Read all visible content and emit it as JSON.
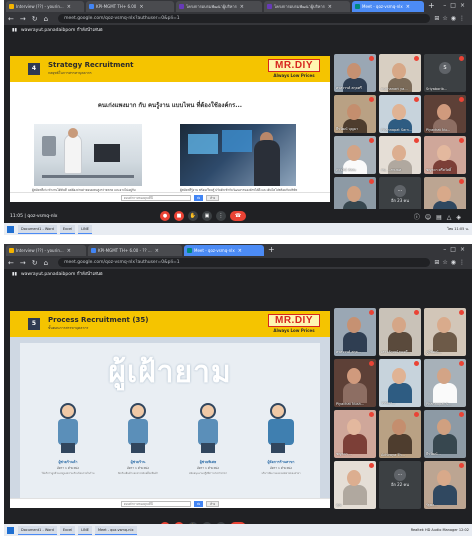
{
  "shot1": {
    "tabs": [
      {
        "label": "Interview (??) - yourin...",
        "color": "#f4b400"
      },
      {
        "label": "KPI-MGMT TH+ 6.00",
        "color": "#4285f4"
      },
      {
        "label": "โครงการอบรมพัฒนาผู้บริหาร",
        "color": "#673ab7"
      },
      {
        "label": "โครงการอบรมพัฒนาผู้บริหาร",
        "color": "#673ab7"
      },
      {
        "label": "Meet - qoz-vsmq-nlx",
        "color": "#00897b",
        "active": true
      }
    ],
    "url": "meet.google.com/qoz-vsmq-nlx?authuser=0&pli=1",
    "presenter": "wawrayut.panadaibpom กำลังนำเสนอ",
    "slide": {
      "number": "4",
      "title": "Strategy Recruitment",
      "subtitle": "กลยุทธ์ในการสรรหาบุคลากร",
      "brand": "MR.DIY",
      "brand_tag": "Always Low Prices",
      "headline": "คนเก่งแพงมาก กับ คนรู้งาน แบบไหน ที่ต้องใช้องค์กร...",
      "caption_left": "ผู้สมัครที่เก่ง ทำงานได้ทันที แต่ต้องจ่ายค่าตอบแทนสูงกว่าตลาด และอาจไม่อยู่กับองค์กรนาน",
      "caption_right": "ผู้สมัครที่รู้งาน พร้อมเรียนรู้ ปรับตัวเข้ากับวัฒนธรรมองค์กรได้ดี และเติบโตไปพร้อมกับบริษัท",
      "form_placeholder": "ตอบคำถามของคุณที่นี่",
      "form_submit": "ส่ง",
      "form_clear": "ล้าง"
    },
    "participants": [
      {
        "name": "ศรสวรรค์ สกุลศรี",
        "bg": "#9aa7b4",
        "skin": "#c69172",
        "shirt": "#2f3e52"
      },
      {
        "name": "nuchanart ya...",
        "bg": "#d8cfc2",
        "skin": "#d7a887",
        "shirt": "#7a6a58"
      },
      {
        "name": "Sriyaborib...",
        "bg": "#3c4043",
        "avatar": "S"
      },
      {
        "name": "ธีรวัฒน์ บุญมา",
        "bg": "#b9a184",
        "skin": "#c48e6e",
        "shirt": "#4e3d2e"
      },
      {
        "name": "Phannapat Sarn...",
        "bg": "#c7d3dc",
        "skin": "#e0b394",
        "shirt": "#2e5c82"
      },
      {
        "name": "Piyachat Nu...",
        "bg": "#5d4037",
        "skin": "#d09a7d",
        "shirt": "#8d6e63"
      },
      {
        "name": "ภาวลิน์ ทัสสะ",
        "bg": "#a7b1b9",
        "skin": "#d3a486",
        "shirt": "#fafafa"
      },
      {
        "name": "กน. ...ทรงยศ",
        "bg": "#e5ded6",
        "skin": "#dcae90",
        "shirt": "#b0a89f"
      },
      {
        "name": "ชญาดา ศรีสวัสดิ์",
        "bg": "#cfa79a",
        "skin": "#e3b89e",
        "shirt": "#7c3f37"
      },
      {
        "name": "รัฐพล ...",
        "bg": "#8d9aa5",
        "skin": "#d0a080",
        "shirt": "#37474f"
      },
      {
        "name": "อีก 23 คน",
        "bg": "#3c4043",
        "more": true
      },
      {
        "name": "คุณ",
        "bg": "#bca592",
        "skin": "#d8a98a",
        "shirt": "#304860"
      }
    ],
    "meeting_time": "11:05",
    "meeting_code": "qoz-vsmq-nlx",
    "taskbar": {
      "items": [
        "Document1 - Word",
        "Excel",
        "LINE"
      ],
      "tray": "ไทย 11:05 น."
    }
  },
  "shot2": {
    "tabs": [
      {
        "label": "Interview (??) - yourin...",
        "color": "#f4b400"
      },
      {
        "label": "KPI-MGMT TH+ 6.00 - ?? ...",
        "color": "#4285f4"
      },
      {
        "label": "Meet - qoz-vsmq-nlx",
        "color": "#00897b",
        "active": true
      }
    ],
    "url": "meet.google.com/qoz-vsmq-nlx?authuser=0&pli=1",
    "presenter": "wawrayut.panadaibpom กำลังนำเสนอ",
    "slide": {
      "number": "5",
      "title": "Process Recruitment (35)",
      "subtitle": "ขั้นตอนการสรรหาบุคลากร",
      "brand": "MR.DIY",
      "brand_tag": "Always Low Prices",
      "big_title": "ผู้เฝ้ายาม",
      "roles": [
        {
          "name": "ผู้ช่วยร้านค้า",
          "rate": "อัตรา 1 ตำแหน่ง",
          "desc": "ให้บริการลูกค้าและดูแลความเรียบร้อยภายในร้าน"
        },
        {
          "name": "ผู้ช่วยร้าน",
          "rate": "อัตรา 1 ตำแหน่ง",
          "desc": "จัดเรียงสินค้าและตรวจนับสต็อกสินค้า"
        },
        {
          "name": "ผู้ช่วยพิเศษ",
          "rate": "อัตรา 1 ตำแหน่ง",
          "desc": "สนับสนุนงานปฏิบัติการประจำสาขา"
        },
        {
          "name": "ผู้จัดการร้านสาขา",
          "rate": "อัตรา 1 ตำแหน่ง",
          "desc": "บริหารทีมงานและยอดขายของสาขา"
        }
      ],
      "form_placeholder": "ตอบคำถามของคุณที่นี่",
      "form_submit": "ส่ง",
      "form_clear": "ล้าง"
    },
    "participants": [
      {
        "name": "ศรสวรรค์ สกุล...",
        "bg": "#9aa7b4",
        "skin": "#c69172",
        "shirt": "#2f3e52"
      },
      {
        "name": "เสาวลักษณ์ ทองดี...",
        "bg": "#c9c2b8",
        "skin": "#d5a687",
        "shirt": "#5a4a3c"
      },
      {
        "name": "ภูมิพัฒน์...",
        "bg": "#d2c6b8",
        "skin": "#d9ab8c",
        "shirt": "#6d5a48"
      },
      {
        "name": "Piyachat Nush...",
        "bg": "#5d4037",
        "skin": "#d09a7d",
        "shirt": "#8d6e63"
      },
      {
        "name": "วรรณา...",
        "bg": "#c7d3dc",
        "skin": "#e0b394",
        "shirt": "#2e5c82"
      },
      {
        "name": "Phannapat S...",
        "bg": "#a7b1b9",
        "skin": "#d3a486",
        "shirt": "#fafafa"
      },
      {
        "name": "ชญาดา ...",
        "bg": "#cfa79a",
        "skin": "#e3b89e",
        "shirt": "#7c3f37"
      },
      {
        "name": "Achiraya Th...",
        "bg": "#b9a184",
        "skin": "#c48e6e",
        "shirt": "#4e3d2e"
      },
      {
        "name": "ธีรวัฒน์...",
        "bg": "#8d9aa5",
        "skin": "#d0a080",
        "shirt": "#37474f"
      },
      {
        "name": "คุณ",
        "bg": "#e5ded6",
        "skin": "#dcae90",
        "shirt": "#b0a89f"
      },
      {
        "name": "อีก 22 คน",
        "bg": "#3c4043",
        "more": true
      },
      {
        "name": "รัฐพล...",
        "bg": "#bca592",
        "skin": "#d8a98a",
        "shirt": "#304860"
      }
    ],
    "meeting_time": "12:02",
    "meeting_code": "qoz-vsmq-nlx",
    "taskbar": {
      "items": [
        "Document1 - Word",
        "Excel",
        "LINE",
        "Meet - qoz-vsmq-nlx"
      ],
      "tray": "Realtek HD Audio Manager 12:02"
    }
  }
}
